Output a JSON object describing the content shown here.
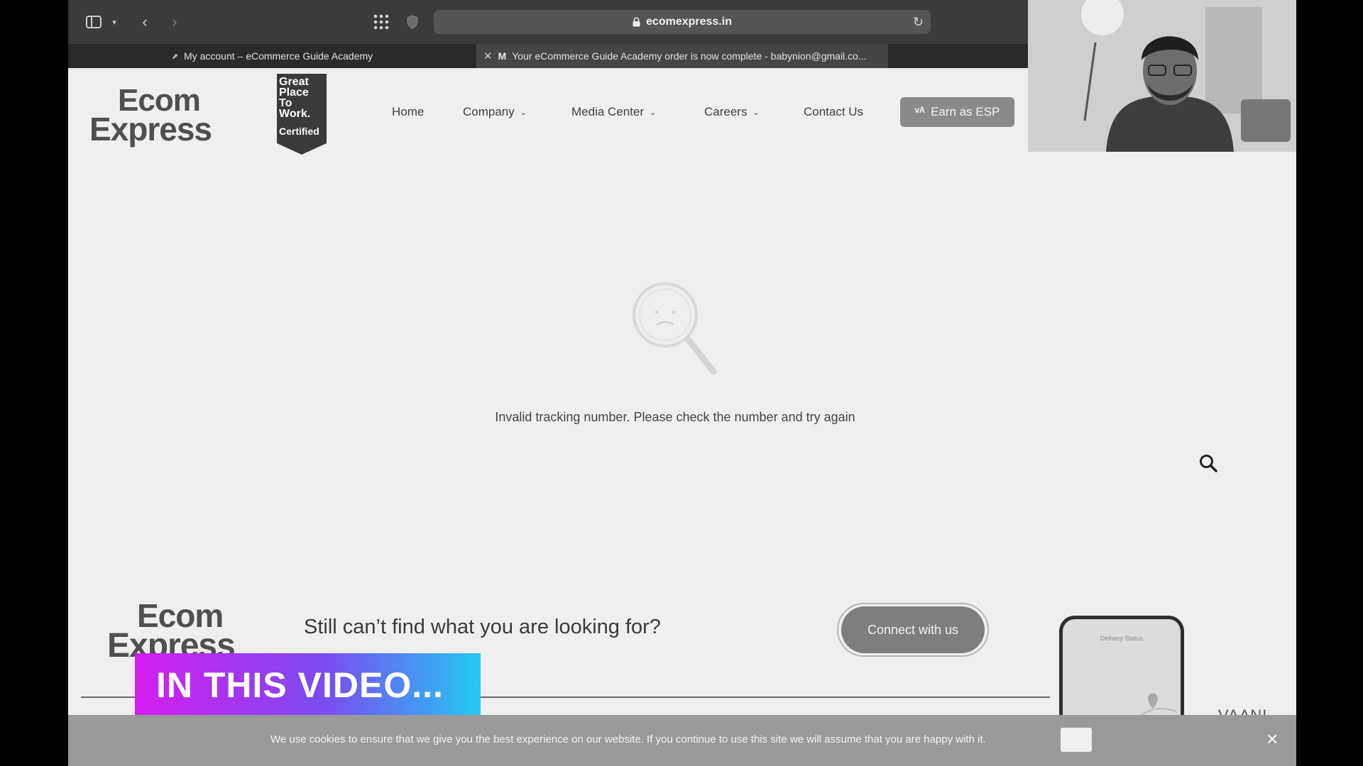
{
  "browser": {
    "url": "ecomexpress.in",
    "tabs": [
      {
        "label": "My account – eCommerce Guide Academy",
        "active": false
      },
      {
        "label": "Your eCommerce Guide Academy order is now complete - babynion@gmail.co...",
        "active": true
      }
    ]
  },
  "header": {
    "logo_top": "Ecom",
    "logo_bottom": "Express",
    "badge": {
      "line1": "Great",
      "line2": "Place",
      "line3": "To",
      "line4": "Work.",
      "certified": "Certified"
    },
    "nav": {
      "home": "Home",
      "company": "Company",
      "media_center": "Media Center",
      "careers": "Careers",
      "contact": "Contact Us"
    },
    "esp_button": "Earn as ESP"
  },
  "main": {
    "message": "Invalid tracking number. Please check the number and try again"
  },
  "footer": {
    "logo_top": "Ecom",
    "logo_bottom": "Express",
    "cta_text": "Still can’t find what you are looking for?",
    "connect_button": "Connect with us",
    "phone_title": "Delivery Status",
    "vaani": "VAANI"
  },
  "banner": {
    "text": "IN THIS VIDEO..."
  },
  "cookie": {
    "text": "We use cookies to ensure that we give you the best experience on our website. If you continue to use this site we will assume that you are happy with it."
  },
  "colors": {
    "chrome": "#3b3b3b",
    "page_bg": "#efefef",
    "banner_start": "#d41df0",
    "banner_end": "#25c8f5"
  }
}
